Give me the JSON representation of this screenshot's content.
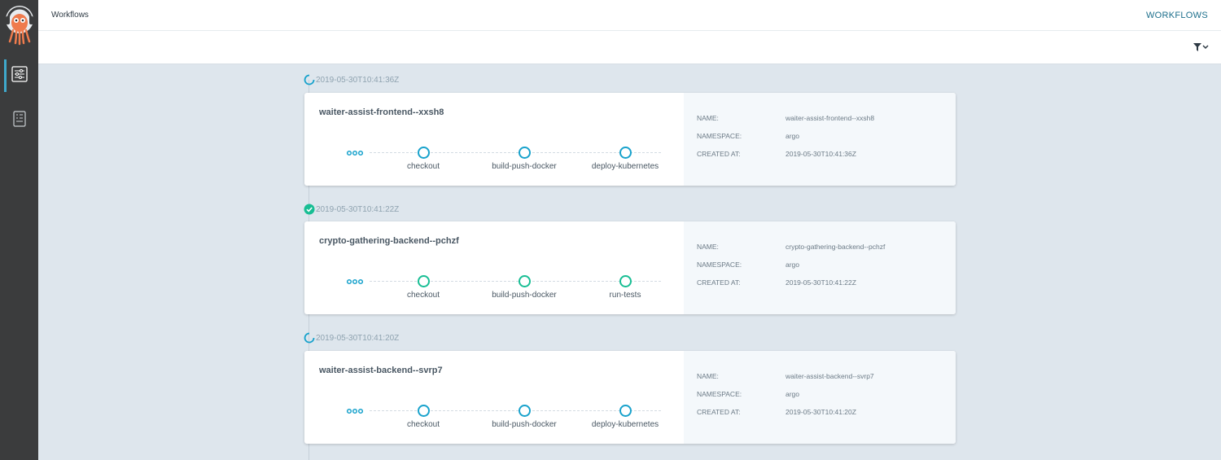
{
  "header": {
    "title": "Workflows",
    "section": "WORKFLOWS"
  },
  "toolbar": {
    "filter_icon": "filter-funnel-icon"
  },
  "sidebar": {
    "items": [
      {
        "icon": "sliders-icon",
        "active": true
      },
      {
        "icon": "document-list-icon",
        "active": false
      }
    ]
  },
  "meta_keys": {
    "name": "NAME:",
    "namespace": "NAMESPACE:",
    "created": "CREATED AT:"
  },
  "workflows": [
    {
      "timestamp": "2019-05-30T10:41:36Z",
      "status": "running",
      "title": "waiter-assist-frontend--xxsh8",
      "steps": [
        "checkout",
        "build-push-docker",
        "deploy-kubernetes"
      ],
      "name": "waiter-assist-frontend--xxsh8",
      "namespace": "argo",
      "created": "2019-05-30T10:41:36Z"
    },
    {
      "timestamp": "2019-05-30T10:41:22Z",
      "status": "succeeded",
      "title": "crypto-gathering-backend--pchzf",
      "steps": [
        "checkout",
        "build-push-docker",
        "run-tests"
      ],
      "name": "crypto-gathering-backend--pchzf",
      "namespace": "argo",
      "created": "2019-05-30T10:41:22Z"
    },
    {
      "timestamp": "2019-05-30T10:41:20Z",
      "status": "running",
      "title": "waiter-assist-backend--svrp7",
      "steps": [
        "checkout",
        "build-push-docker",
        "deploy-kubernetes"
      ],
      "name": "waiter-assist-backend--svrp7",
      "namespace": "argo",
      "created": "2019-05-30T10:41:20Z"
    }
  ],
  "colors": {
    "running": "#18a2cc",
    "succeeded": "#18be94",
    "accent": "#1c6f8c",
    "sidebar": "#3b3c3d"
  }
}
